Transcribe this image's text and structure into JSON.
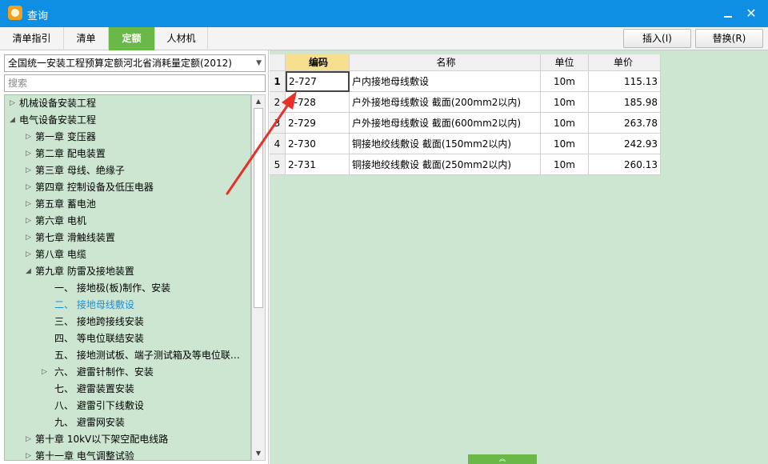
{
  "window": {
    "title": "查询",
    "minimize_label": "",
    "close_label": "✕"
  },
  "tabs": [
    {
      "label": "清单指引",
      "active": false
    },
    {
      "label": "清单",
      "active": false
    },
    {
      "label": "定额",
      "active": true
    },
    {
      "label": "人材机",
      "active": false
    }
  ],
  "actions": {
    "insert_label": "插入(I)",
    "replace_label": "替换(R)"
  },
  "library_select": {
    "value": "全国统一安装工程预算定额河北省消耗量定额(2012)"
  },
  "search": {
    "placeholder": "搜索"
  },
  "tree": [
    {
      "label": "机械设备安装工程",
      "level": 0,
      "toggle": "▷"
    },
    {
      "label": "电气设备安装工程",
      "level": 0,
      "toggle": "◢"
    },
    {
      "label": "第一章  变压器",
      "level": 1,
      "toggle": "▷"
    },
    {
      "label": "第二章  配电装置",
      "level": 1,
      "toggle": "▷"
    },
    {
      "label": "第三章  母线、绝缘子",
      "level": 1,
      "toggle": "▷"
    },
    {
      "label": "第四章  控制设备及低压电器",
      "level": 1,
      "toggle": "▷"
    },
    {
      "label": "第五章  蓄电池",
      "level": 1,
      "toggle": "▷"
    },
    {
      "label": "第六章  电机",
      "level": 1,
      "toggle": "▷"
    },
    {
      "label": "第七章  滑触线装置",
      "level": 1,
      "toggle": "▷"
    },
    {
      "label": "第八章  电缆",
      "level": 1,
      "toggle": "▷"
    },
    {
      "label": "第九章  防雷及接地装置",
      "level": 1,
      "toggle": "◢"
    },
    {
      "label": "一、  接地极(板)制作、安装",
      "level": 2,
      "toggle": ""
    },
    {
      "label": "二、  接地母线敷设",
      "level": 2,
      "toggle": "",
      "selected": true
    },
    {
      "label": "三、  接地跨接线安装",
      "level": 2,
      "toggle": ""
    },
    {
      "label": "四、  等电位联结安装",
      "level": 2,
      "toggle": ""
    },
    {
      "label": "五、  接地测试板、端子测试箱及等电位联…",
      "level": 2,
      "toggle": ""
    },
    {
      "label": "六、  避雷针制作、安装",
      "level": 2,
      "toggle": "▷"
    },
    {
      "label": "七、  避雷装置安装",
      "level": 2,
      "toggle": ""
    },
    {
      "label": "八、  避雷引下线敷设",
      "level": 2,
      "toggle": ""
    },
    {
      "label": "九、  避雷网安装",
      "level": 2,
      "toggle": ""
    },
    {
      "label": "第十章  10kV以下架空配电线路",
      "level": 1,
      "toggle": "▷"
    },
    {
      "label": "第十一章  电气调整试验",
      "level": 1,
      "toggle": "▷"
    }
  ],
  "table": {
    "columns": [
      "",
      "编码",
      "名称",
      "单位",
      "单价"
    ],
    "rows": [
      {
        "num": "1",
        "code": "2-727",
        "name": "户内接地母线敷设",
        "unit": "10m",
        "price": "115.13"
      },
      {
        "num": "2",
        "code": "2-728",
        "name": "户外接地母线敷设 截面(200mm2以内)",
        "unit": "10m",
        "price": "185.98"
      },
      {
        "num": "3",
        "code": "2-729",
        "name": "户外接地母线敷设 截面(600mm2以内)",
        "unit": "10m",
        "price": "263.78"
      },
      {
        "num": "4",
        "code": "2-730",
        "name": "铜接地绞线敷设 截面(150mm2以内)",
        "unit": "10m",
        "price": "242.93"
      },
      {
        "num": "5",
        "code": "2-731",
        "name": "铜接地绞线敷设 截面(250mm2以内)",
        "unit": "10m",
        "price": "260.13"
      }
    ]
  },
  "colors": {
    "titlebar": "#0f8fe4",
    "active_tab": "#6ab847",
    "panel_bg": "#cde6d1",
    "selected_node": "#1a8fe0",
    "code_header": "#f7e08d",
    "annotation_arrow": "#e8302a"
  }
}
